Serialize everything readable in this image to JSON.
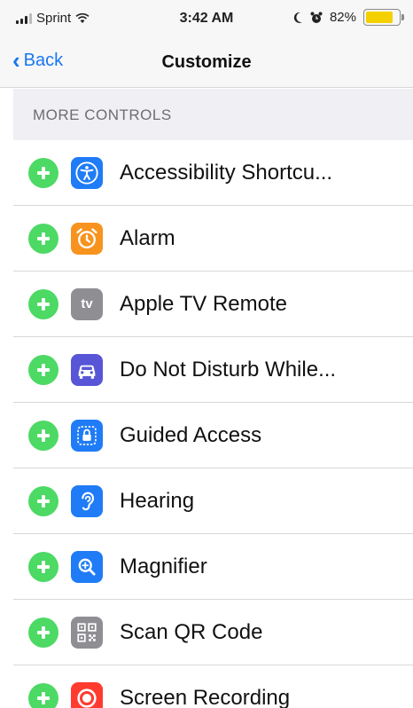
{
  "status_bar": {
    "carrier": "Sprint",
    "time": "3:42 AM",
    "battery_pct": "82%",
    "battery_level": 0.82
  },
  "nav": {
    "back_label": "Back",
    "title": "Customize"
  },
  "section": {
    "header": "MORE CONTROLS"
  },
  "controls": [
    {
      "label": "Accessibility Shortcu...",
      "icon": "accessibility-icon",
      "color": "#1f7cf6"
    },
    {
      "label": "Alarm",
      "icon": "alarm-clock-icon",
      "color": "#f7931e"
    },
    {
      "label": "Apple TV Remote",
      "icon": "apple-tv-icon",
      "color": "#8e8e93",
      "icon_text": "tv"
    },
    {
      "label": "Do Not Disturb While...",
      "icon": "car-icon",
      "color": "#5856d6"
    },
    {
      "label": "Guided Access",
      "icon": "lock-icon",
      "color": "#1f7cf6"
    },
    {
      "label": "Hearing",
      "icon": "ear-icon",
      "color": "#1f7cf6"
    },
    {
      "label": "Magnifier",
      "icon": "magnifier-icon",
      "color": "#1f7cf6"
    },
    {
      "label": "Scan QR Code",
      "icon": "qr-code-icon",
      "color": "#8e8e93"
    },
    {
      "label": "Screen Recording",
      "icon": "screen-record-icon",
      "color": "#ff3b30"
    }
  ]
}
